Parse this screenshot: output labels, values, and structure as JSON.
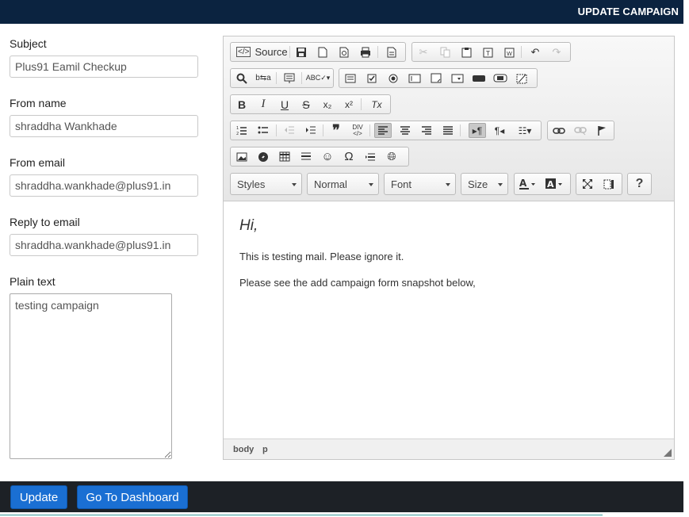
{
  "header": {
    "title": "UPDATE CAMPAIGN",
    "bg": "#0b2340"
  },
  "form": {
    "subject_label": "Subject",
    "subject_value": "Plus91 Eamil Checkup",
    "from_name_label": "From name",
    "from_name_value": "shraddha Wankhade",
    "from_email_label": "From email",
    "from_email_value": "shraddha.wankhade@plus91.in",
    "reply_to_label": "Reply to email",
    "reply_to_value": "shraddha.wankhade@plus91.in",
    "plain_text_label": "Plain text",
    "plain_text_value": "testing campaign"
  },
  "editor": {
    "toolbar": {
      "source_label": "Source",
      "styles_label": "Styles",
      "format_label": "Normal",
      "font_label": "Font",
      "size_label": "Size",
      "help_label": "?",
      "bold": "B",
      "italic": "I",
      "underline": "U",
      "strike": "S",
      "subscript": "x₂",
      "superscript": "x²",
      "remove_format": "Tx"
    },
    "content": {
      "greeting": "Hi,",
      "paragraph1": "This is testing mail. Please ignore it.",
      "paragraph2": "Please see the add campaign form snapshot below,"
    },
    "status": {
      "crumb1": "body",
      "crumb2": "p"
    }
  },
  "footer": {
    "update_label": "Update",
    "dashboard_label": "Go To Dashboard",
    "button_color": "#1a6fd3"
  }
}
